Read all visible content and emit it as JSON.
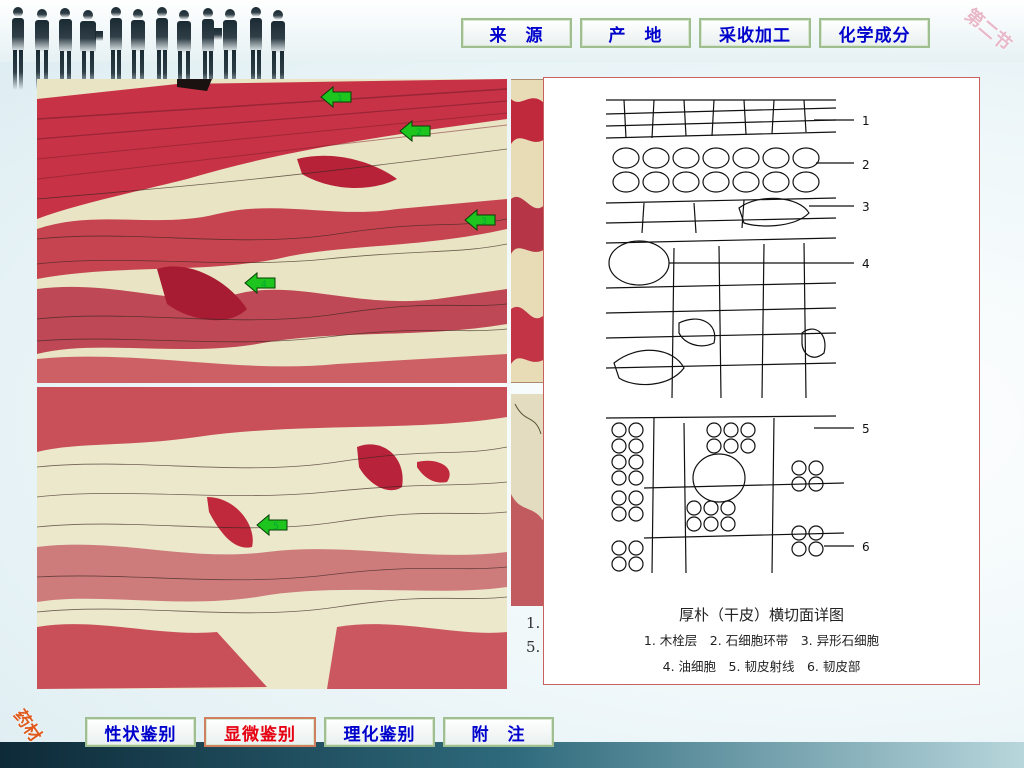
{
  "top_nav": {
    "items": [
      {
        "label": "来　源"
      },
      {
        "label": "产　地"
      },
      {
        "label": "采收加工"
      },
      {
        "label": "化学成分"
      }
    ]
  },
  "section_stamp": "第二节",
  "bottom_stamp": "药材",
  "bottom_nav": {
    "items": [
      {
        "label": "性状鉴别"
      },
      {
        "label": "显微鉴别",
        "active": true
      },
      {
        "label": "理化鉴别"
      },
      {
        "label": "附　注"
      }
    ]
  },
  "micrograph_top": {
    "arrows": [
      "1",
      "2",
      "3",
      "4"
    ]
  },
  "micrograph_bottom": {
    "arrows": [
      "5"
    ]
  },
  "diagram": {
    "title": "厚朴（干皮）横切面详图",
    "legend_line1": "1. 木栓层　2. 石细胞环带　3. 异形石细胞",
    "legend_line2": "4. 油细胞　5. 韧皮射线　6. 韧皮部",
    "labels": [
      "1",
      "2",
      "3",
      "4",
      "5",
      "6"
    ]
  },
  "partial_left_text": [
    "1.",
    "5."
  ],
  "colors": {
    "nav_text": "#0000cc",
    "nav_active_text": "#e60012",
    "nav_border": "#9fbf91",
    "stain_red": "#c0283c"
  }
}
